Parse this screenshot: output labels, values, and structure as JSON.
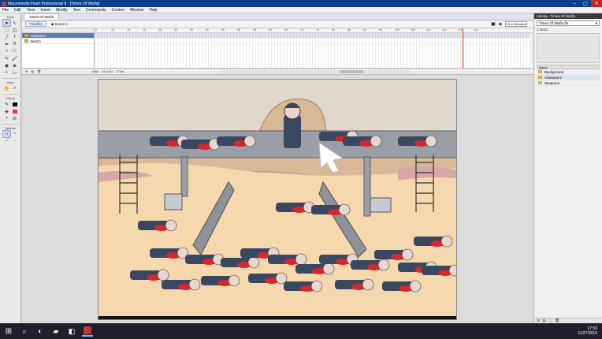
{
  "window": {
    "title": "Macromedia Flash Professional 8 - [Times Of Warfa]",
    "min": "–",
    "max": "▢",
    "close": "✕"
  },
  "menu": [
    "File",
    "Edit",
    "View",
    "Insert",
    "Modify",
    "Text",
    "Commands",
    "Control",
    "Window",
    "Help"
  ],
  "tools": {
    "label_tools": "Tools",
    "label_view": "View",
    "label_colors": "Colors",
    "label_options": "Options"
  },
  "document": {
    "tab": "Times Of Warfa",
    "timeline_button": "Timeline",
    "scene": "Scene 1",
    "zoom": "Fit in Window"
  },
  "layers": [
    {
      "name": "Animation",
      "selected": true
    },
    {
      "name": "Sketch",
      "selected": false
    }
  ],
  "ruler_marks": [
    "5",
    "10",
    "15",
    "20",
    "25",
    "30",
    "35",
    "40",
    "45",
    "50",
    "55",
    "60",
    "65",
    "70",
    "75",
    "80",
    "85",
    "90",
    "95",
    "100",
    "105",
    "110",
    "115",
    "120",
    "125"
  ],
  "status": {
    "frame": "1866",
    "fps": "24.0 fps",
    "time": "77.6s"
  },
  "library": {
    "title": "Library - Times Of Warfa",
    "document": "Times Of Warfa.fla",
    "count": "3 items",
    "column_name": "Name",
    "folders": [
      "Background",
      "Characters",
      "Weapons"
    ]
  },
  "taskbar": {
    "time": "17:53",
    "date": "11/27/2019"
  },
  "colors": {
    "sky": "#e2d7cd",
    "sand": "#f5d8ad",
    "rock": "#d8b896",
    "beam": "#9a9ea6",
    "blood": "#d8262a",
    "uniform": "#3a4761"
  }
}
